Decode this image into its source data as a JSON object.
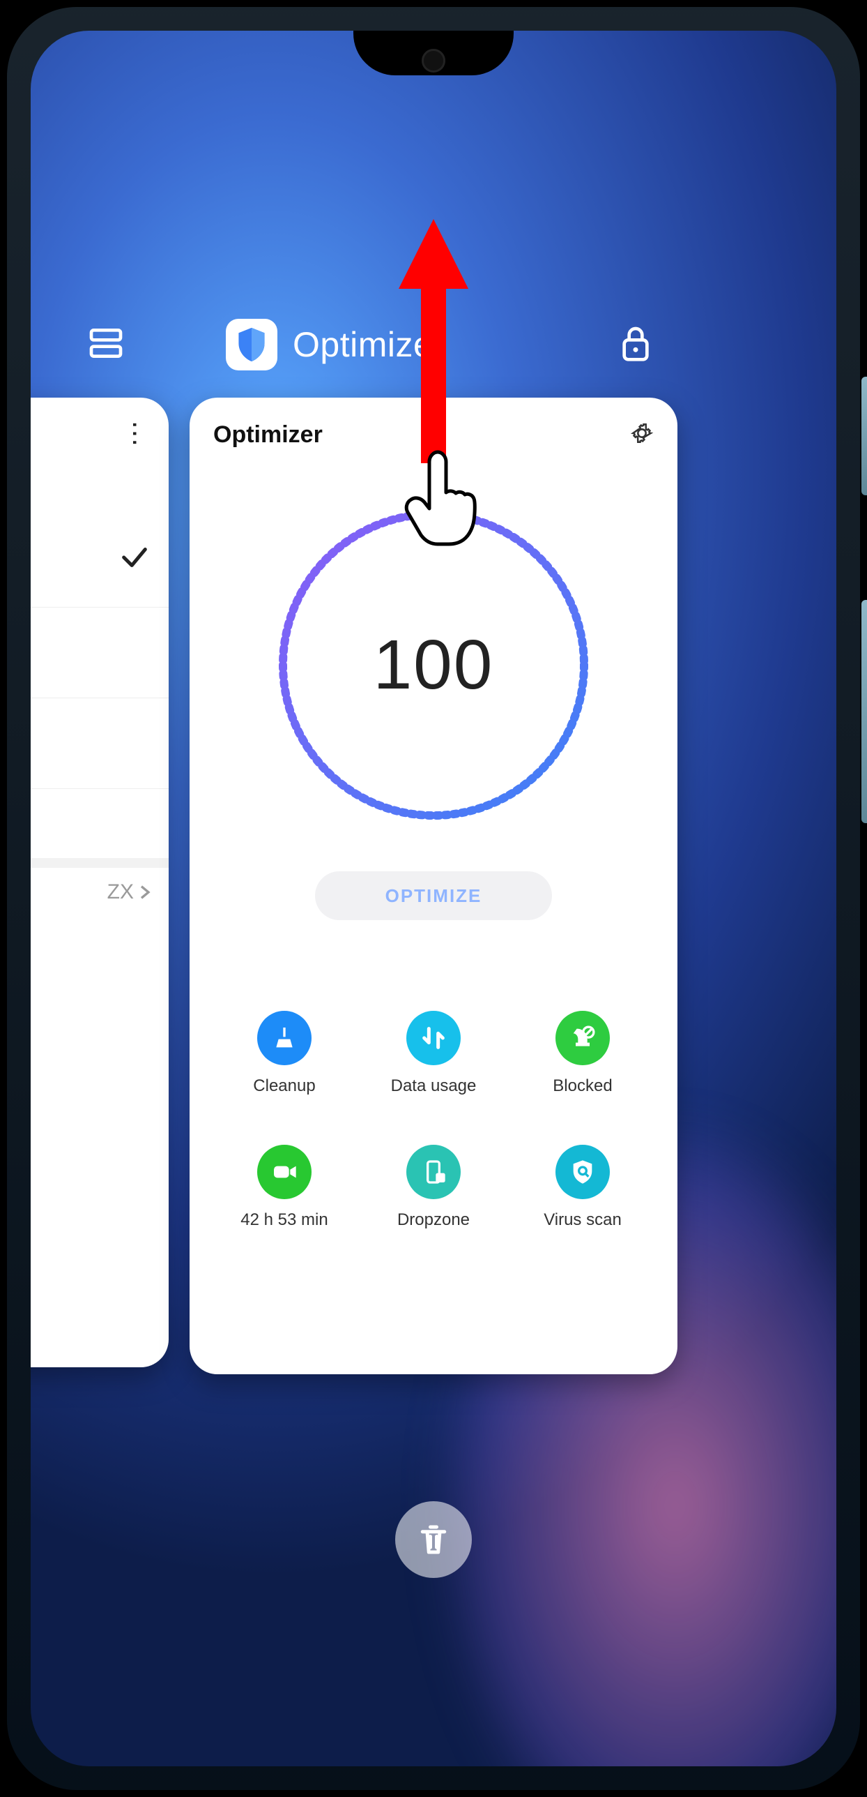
{
  "recents": {
    "app_title": "Optimizer",
    "prev_card": {
      "tag": "ZX"
    },
    "clear_all_icon": "trash-icon",
    "lock_icon": "lock-icon",
    "layout_icon": "layout-rows-icon"
  },
  "optimizer": {
    "title": "Optimizer",
    "score": "100",
    "button": "OPTIMIZE",
    "tools": [
      {
        "label": "Cleanup",
        "icon": "broom-icon",
        "color": "c-blue"
      },
      {
        "label": "Data usage",
        "icon": "arrows-icon",
        "color": "c-cyan"
      },
      {
        "label": "Blocked",
        "icon": "block-icon",
        "color": "c-green"
      },
      {
        "label": "42 h 53 min",
        "icon": "video-icon",
        "color": "c-green2"
      },
      {
        "label": "Dropzone",
        "icon": "phone-icon",
        "color": "c-teal"
      },
      {
        "label": "Virus scan",
        "icon": "shield-icon",
        "color": "c-aqua"
      }
    ]
  }
}
